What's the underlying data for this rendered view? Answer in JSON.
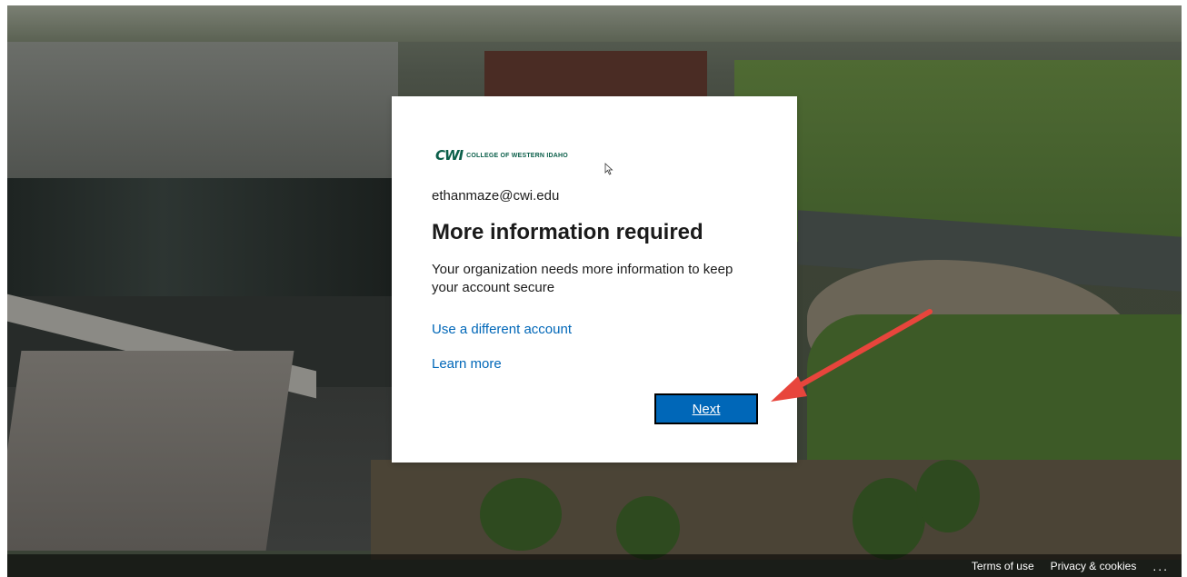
{
  "dialog": {
    "logo": {
      "mark": "CWI",
      "text": "COLLEGE OF WESTERN IDAHO"
    },
    "identity": "ethanmaze@cwi.edu",
    "title": "More information required",
    "description": "Your organization needs more information to keep your account secure",
    "links": {
      "different_account": "Use a different account",
      "learn_more": "Learn more"
    },
    "next_label": "Next"
  },
  "footer": {
    "terms": "Terms of use",
    "privacy": "Privacy & cookies",
    "more": "..."
  },
  "colors": {
    "accent": "#0067b8",
    "annotation_arrow": "#e8453c",
    "logo_green": "#0b5f4a"
  },
  "icons": [
    "mouse-pointer-icon",
    "annotation-arrow-icon",
    "more-options-icon"
  ]
}
